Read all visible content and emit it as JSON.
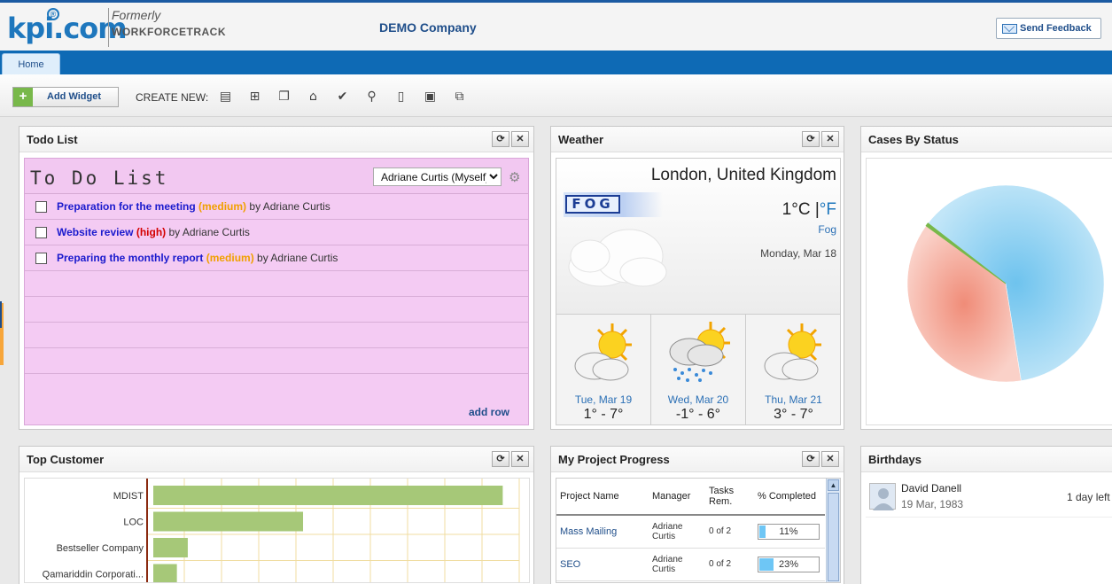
{
  "header": {
    "logo_main": "kpi",
    "logo_tld": ".com",
    "logo_formerly": "Formerly",
    "logo_former_name": "WORKFORCETRACK",
    "company": "DEMO Company",
    "feedback_label": "Send Feedback"
  },
  "nav": {
    "tabs": [
      {
        "label": "Home",
        "active": true
      }
    ]
  },
  "toolbar": {
    "add_widget_label": "Add Widget",
    "create_new_label": "CREATE NEW:",
    "create_icons": [
      "list-icon",
      "org-chart-icon",
      "documents-icon",
      "house-icon",
      "checkmark-icon",
      "person-document-icon",
      "page-icon",
      "report-icon",
      "network-icon"
    ]
  },
  "todo": {
    "title": "Todo List",
    "handwritten_title": "To Do List",
    "assignee_selected": "Adriane Curtis (Myself)",
    "items": [
      {
        "task": "Preparation for the meeting",
        "priority": "(medium)",
        "level": "medium",
        "by": "by Adriane Curtis"
      },
      {
        "task": "Website review",
        "priority": "(high)",
        "level": "high",
        "by": "by Adriane Curtis"
      },
      {
        "task": "Preparing the monthly report",
        "priority": "(medium)",
        "level": "medium",
        "by": "by Adriane Curtis"
      }
    ],
    "add_row_label": "add row"
  },
  "weather": {
    "title": "Weather",
    "location": "London, United Kingdom",
    "banner": "FOG",
    "temp": "1°C",
    "unit_alt": "°F",
    "condition": "Fog",
    "date": "Monday, Mar 18",
    "forecast": [
      {
        "day": "Tue, Mar 19",
        "range": "1° - 7°",
        "icon": "sun-cloud-icon"
      },
      {
        "day": "Wed, Mar 20",
        "range": "-1° - 6°",
        "icon": "sun-rain-cloud-icon"
      },
      {
        "day": "Thu, Mar 21",
        "range": "3° - 7°",
        "icon": "sun-cloud-icon"
      }
    ]
  },
  "cases": {
    "title": "Cases By Status"
  },
  "top_customer": {
    "title": "Top Customer"
  },
  "project": {
    "title": "My Project Progress",
    "columns": [
      "Project Name",
      "Manager",
      "Tasks Rem.",
      "% Completed"
    ],
    "rows": [
      {
        "name": "Mass Mailing",
        "manager": "Adriane Curtis",
        "tasks": "0 of 2",
        "pct_label": "11%",
        "pct": 11
      },
      {
        "name": "SEO",
        "manager": "Adriane Curtis",
        "tasks": "0 of 2",
        "pct_label": "23%",
        "pct": 23
      }
    ]
  },
  "birthdays": {
    "title": "Birthdays",
    "items": [
      {
        "name": "David Danell",
        "date": "19 Mar, 1983",
        "left": "1 day left"
      }
    ]
  },
  "chart_data": [
    {
      "type": "pie",
      "title": "Cases By Status",
      "values": [
        0.62,
        0.375,
        0.005
      ],
      "colors": [
        "#9dd7f2",
        "#f09a88",
        "#78b84a"
      ]
    },
    {
      "type": "bar",
      "title": "Top Customer",
      "orientation": "horizontal",
      "categories": [
        "MDIST",
        "LOC",
        "Bestseller Company",
        "Qamariddin Corporati..."
      ],
      "values": [
        385,
        165,
        38,
        26
      ],
      "xlim": [
        0,
        410
      ],
      "color": "#a6c878"
    }
  ]
}
